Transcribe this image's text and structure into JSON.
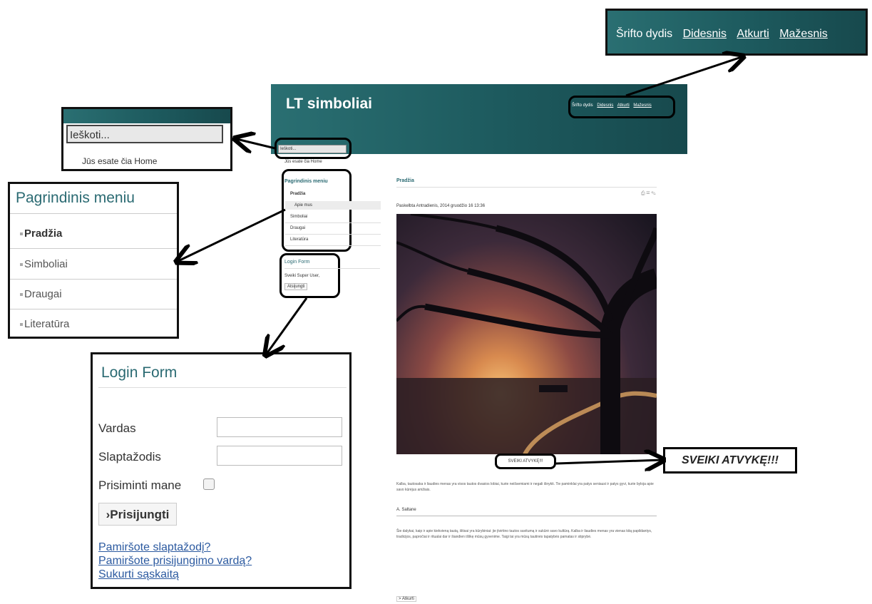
{
  "font_callout": {
    "label": "Šrifto dydis",
    "bigger": "Didesnis",
    "reset": "Atkurti",
    "smaller": "Mažesnis"
  },
  "site": {
    "title": "LT simboliai",
    "font_label": "Šrifto dydis",
    "font_bigger": "Didesnis",
    "font_reset": "Atkurti",
    "font_smaller": "Mažesnis",
    "search_placeholder": "Ieškoti...",
    "breadcrumb": "Jūs esate čia  Home"
  },
  "search_zoom": {
    "placeholder": "Ieškoti...",
    "breadcrumb": "Jūs esate čia  Home"
  },
  "menu": {
    "title": "Pagrindinis meniu",
    "items": [
      "Pradžia",
      "Simboliai",
      "Draugai",
      "Literatūra"
    ],
    "sub_item": "Apie mus"
  },
  "login_small": {
    "title": "Login Form",
    "greeting": "Sveiki Super User,",
    "logout": "Atsijungti"
  },
  "login": {
    "title": "Login Form",
    "username_label": "Vardas",
    "password_label": "Slaptažodis",
    "remember_label": "Prisiminti mane",
    "submit": "›Prisijungti",
    "forgot_password": "Pamiršote slaptažodį?",
    "forgot_username": "Pamiršote prisijungimo vardą?",
    "create_account": "Sukurti sąskaitą"
  },
  "article": {
    "heading": "Pradžia",
    "meta": "Paskelbta Antradienis, 2014 gruodžio 16 13:36",
    "caption": "SVEIKI ATVYKĘ!!!",
    "quote_author": "A. Saltane",
    "read_more": "> Atkurti",
    "quote_text": "Kalba, tautosaka ir liaudies menas yra visos tautos dvasios lobiai, kurie neišsemiami ir negali išnykti. Tie paminklai yra patys seniausi ir patys gyvi, kurie byloja apie savo kūrėjus amžiais.",
    "body_text": "Šie dalykai, kaip ir apie kiekvieną tautą, ištisai yra kūrybiniai: jie įtvirtino tautos savitumą ir sukūrė savo kultūrą. Kalba ir liaudies menas yra vienas kitą papildantys, tradicijos, papročiai ir ritualai dar ir šiandien išlikę mūsų gyvenime. Taigi tai yra mūsų tautinės tapatybės pamatas ir stiprybė."
  },
  "callout_large": "SVEIKI ATVYKĘ!!!"
}
